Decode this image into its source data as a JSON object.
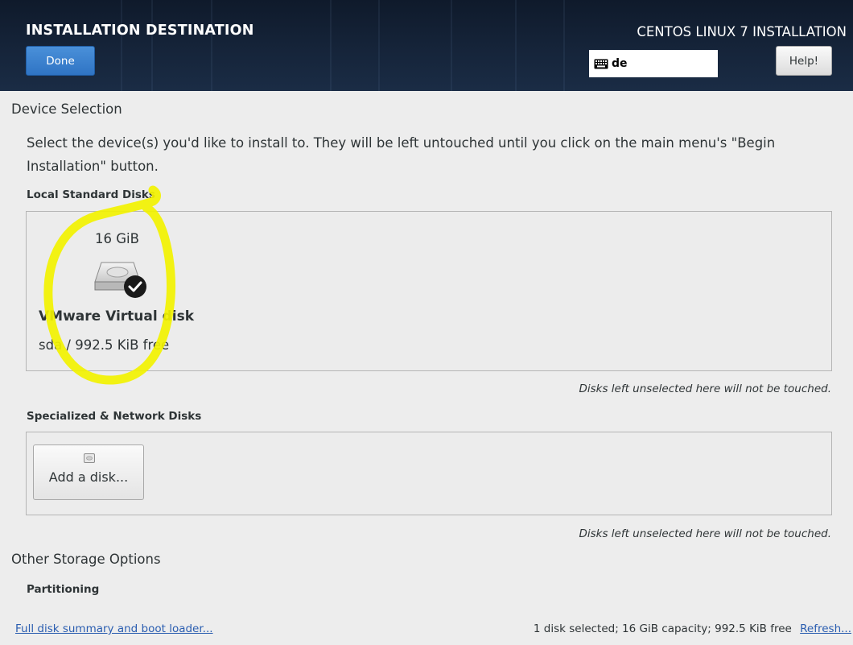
{
  "header": {
    "title": "INSTALLATION DESTINATION",
    "done_label": "Done",
    "product": "CENTOS LINUX 7 INSTALLATION",
    "keyboard_layout": "de",
    "help_label": "Help!"
  },
  "device_selection": {
    "title": "Device Selection",
    "description": "Select the device(s) you'd like to install to.  They will be left untouched until you click on the main menu's \"Begin Installation\" button."
  },
  "local_disks": {
    "heading": "Local Standard Disks",
    "disks": [
      {
        "size": "16 GiB",
        "name": "VMware Virtual disk",
        "free": "sda  /  992.5 KiB free",
        "selected": true
      }
    ],
    "note": "Disks left unselected here will not be touched."
  },
  "specialized_disks": {
    "heading": "Specialized & Network Disks",
    "add_label": "Add a disk...",
    "note": "Disks left unselected here will not be touched."
  },
  "other_storage": {
    "title": "Other Storage Options",
    "partitioning_label": "Partitioning"
  },
  "footer": {
    "summary_link": "Full disk summary and boot loader...",
    "status": "1 disk selected; 16 GiB capacity; 992.5 KiB free",
    "refresh_link": "Refresh..."
  },
  "colors": {
    "accent": "#3b83d0",
    "header_bg": "#16253b",
    "highlight_annotation": "#f5f500"
  }
}
